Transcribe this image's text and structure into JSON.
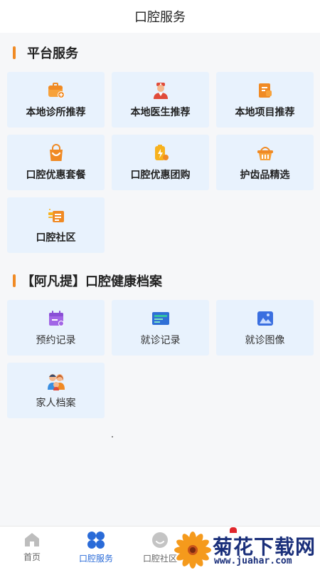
{
  "header": {
    "title": "口腔服务"
  },
  "platform": {
    "title": "平台服务",
    "items": [
      {
        "label": "本地诊所推荐",
        "icon": "clinic-icon"
      },
      {
        "label": "本地医生推荐",
        "icon": "doctor-icon"
      },
      {
        "label": "本地项目推荐",
        "icon": "project-icon"
      },
      {
        "label": "口腔优惠套餐",
        "icon": "shopping-bag-icon"
      },
      {
        "label": "口腔优惠团购",
        "icon": "group-buy-icon"
      },
      {
        "label": "护齿品精选",
        "icon": "basket-icon"
      },
      {
        "label": "口腔社区",
        "icon": "community-icon"
      }
    ]
  },
  "archive": {
    "title": "【阿凡提】口腔健康档案",
    "items": [
      {
        "label": "预约记录",
        "icon": "calendar-icon"
      },
      {
        "label": "就诊记录",
        "icon": "record-icon"
      },
      {
        "label": "就诊图像",
        "icon": "image-icon"
      },
      {
        "label": "家人档案",
        "icon": "family-icon"
      }
    ]
  },
  "tabbar": {
    "items": [
      {
        "label": "首页",
        "icon": "home-icon",
        "active": false
      },
      {
        "label": "口腔服务",
        "icon": "grid-icon",
        "active": true
      },
      {
        "label": "口腔社区",
        "icon": "smile-icon",
        "active": false
      }
    ]
  },
  "watermark": {
    "title": "菊花下载网",
    "url": "www.juahar.com"
  },
  "colors": {
    "accent": "#f08a24",
    "active_tab": "#2a6bd8",
    "card_bg": "#e8f2fd"
  }
}
